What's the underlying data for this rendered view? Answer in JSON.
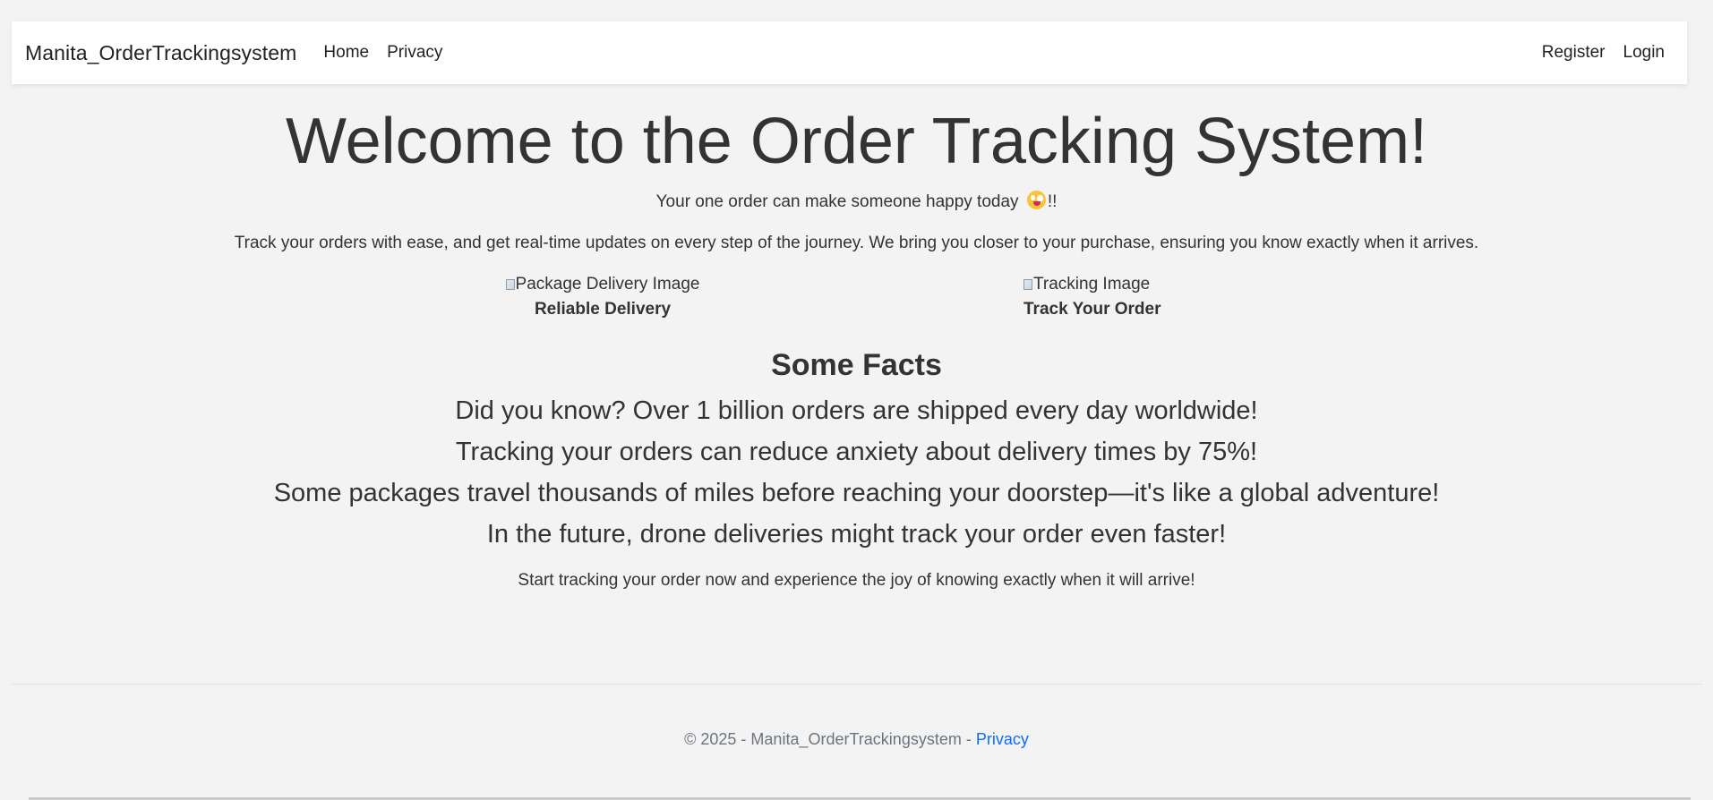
{
  "navbar": {
    "brand": "Manita_OrderTrackingsystem",
    "links": [
      "Home",
      "Privacy"
    ],
    "auth": {
      "register": "Register",
      "login": "Login"
    }
  },
  "hero": {
    "title": "Welcome to the Order Tracking System!",
    "tagline_before": "Your one order can make someone happy today ",
    "tagline_after": "!!",
    "emoji_icon": "zany-face-emoji-icon",
    "intro": "Track your orders with ease, and get real-time updates on every step of the journey. We bring you closer to your purchase, ensuring you know exactly when it arrives."
  },
  "features": [
    {
      "image_alt": "Package Delivery Image",
      "caption": "Reliable Delivery"
    },
    {
      "image_alt": "Tracking Image",
      "caption": "Track Your Order"
    }
  ],
  "facts": {
    "heading": "Some Facts",
    "items": [
      "Did you know? Over 1 billion orders are shipped every day worldwide!",
      "Tracking your orders can reduce anxiety about delivery times by 75%!",
      "Some packages travel thousands of miles before reaching your doorstep—it's like a global adventure!",
      "In the future, drone deliveries might track your order even faster!"
    ],
    "closing": "Start tracking your order now and experience the joy of knowing exactly when it will arrive!"
  },
  "footer": {
    "text": "© 2025 - Manita_OrderTrackingsystem - ",
    "privacy_link": "Privacy",
    "link_color": "#0d6efd"
  }
}
